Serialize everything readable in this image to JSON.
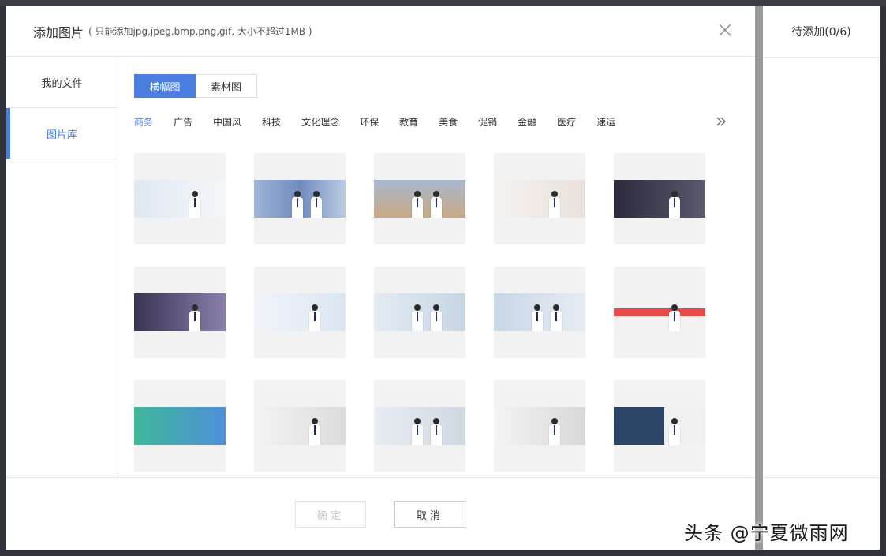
{
  "dialog": {
    "title": "添加图片",
    "subtitle": "( 只能添加jpg,jpeg,bmp,png,gif, 大小不超过1MB )"
  },
  "right_panel": {
    "pending_label": "待添加(0/6)"
  },
  "sidebar": {
    "items": [
      {
        "label": "我的文件",
        "active": false
      },
      {
        "label": "图片库",
        "active": true
      }
    ]
  },
  "tabs": [
    {
      "label": "横幅图",
      "active": true
    },
    {
      "label": "素材图",
      "active": false
    }
  ],
  "categories": [
    "商务",
    "广告",
    "中国风",
    "科技",
    "文化理念",
    "环保",
    "教育",
    "美食",
    "促销",
    "金融",
    "医疗",
    "速运"
  ],
  "thumbnails": [
    {
      "bg": "linear-gradient(90deg,#dfe8f0,#f4f7fa)",
      "people": 1
    },
    {
      "bg": "linear-gradient(90deg,#9fb5d6,#6f8bbf 50%,#bccbe2)",
      "people": 2
    },
    {
      "bg": "linear-gradient(180deg,#a8b8cf,#c9a882)",
      "people": 2
    },
    {
      "bg": "linear-gradient(90deg,#f6f2ef,#e8e1dc)",
      "people": 1
    },
    {
      "bg": "linear-gradient(90deg,#2a2a3a,#5a5a70)",
      "people": 1
    },
    {
      "bg": "linear-gradient(90deg,#3a3452,#8c7fae)",
      "people": 1
    },
    {
      "bg": "linear-gradient(90deg,#f0f4f8,#dbe6f2)",
      "people": 1
    },
    {
      "bg": "linear-gradient(90deg,#e3ebf2,#c7d6e4)",
      "people": 2
    },
    {
      "bg": "linear-gradient(90deg,#c9d6e6,#e6ecf3)",
      "people": 2
    },
    {
      "bg": "linear-gradient(180deg,#f2f2f2 40%,#e84a4a 40%,#e84a4a 60%,#f2f2f2 60%)",
      "people": 1
    },
    {
      "bg": "linear-gradient(90deg,#3fb89a,#4f8fd9)",
      "people": 0
    },
    {
      "bg": "linear-gradient(90deg,#f3f3f3,#dcdcdc)",
      "people": 1
    },
    {
      "bg": "linear-gradient(90deg,#e8edf2,#cfd8e2)",
      "people": 2
    },
    {
      "bg": "linear-gradient(90deg,#f4f4f4,#d8d8d8)",
      "people": 1
    },
    {
      "bg": "linear-gradient(90deg,#2c4466 55%,#f0f0f0 55%)",
      "people": 1
    }
  ],
  "footer": {
    "confirm_label": "确定",
    "cancel_label": "取消"
  },
  "watermark": "头条 @宁夏微雨网",
  "colors": {
    "accent": "#4a7fe0",
    "border": "#e6e6e6"
  }
}
